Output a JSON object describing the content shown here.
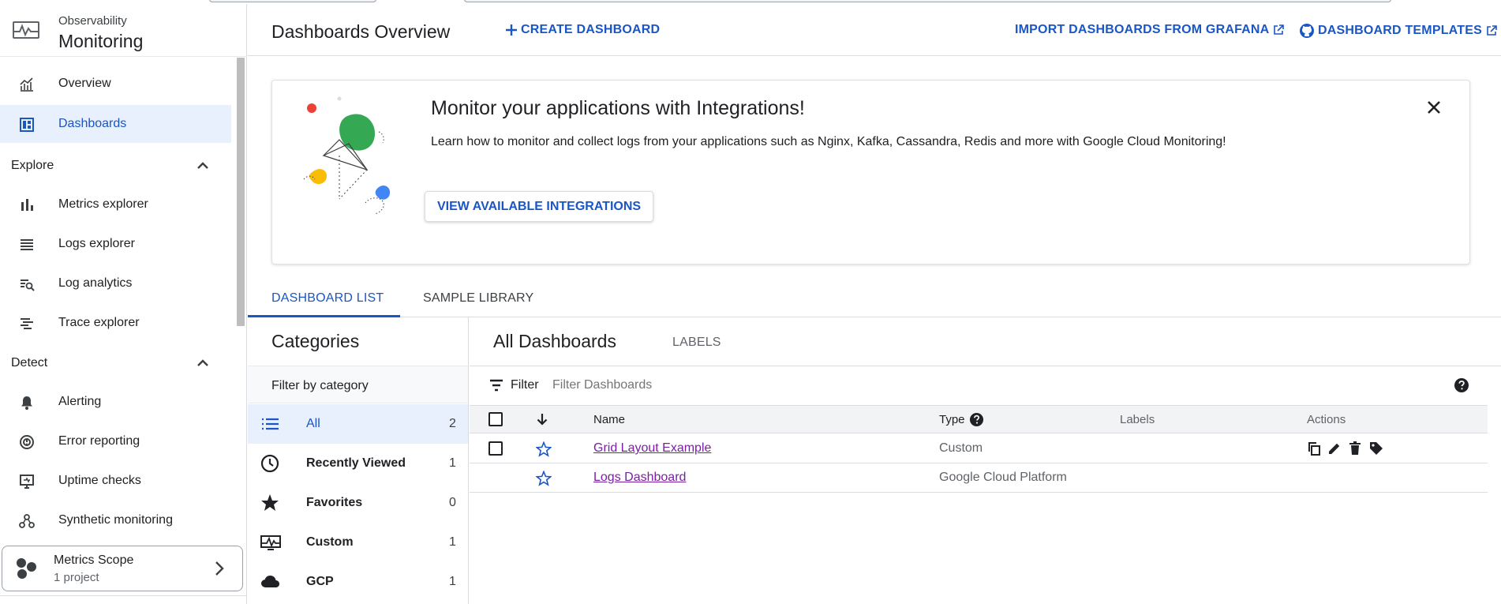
{
  "sidebar": {
    "product_group": "Observability",
    "product_name": "Monitoring",
    "items_top": [
      {
        "label": "Overview",
        "icon": "chart-line-icon"
      },
      {
        "label": "Dashboards",
        "icon": "dashboard-icon",
        "active": true
      }
    ],
    "explore": {
      "heading": "Explore",
      "items": [
        {
          "label": "Metrics explorer",
          "icon": "bar-chart-icon"
        },
        {
          "label": "Logs explorer",
          "icon": "list-lines-icon"
        },
        {
          "label": "Log analytics",
          "icon": "list-search-icon"
        },
        {
          "label": "Trace explorer",
          "icon": "trace-icon"
        }
      ]
    },
    "detect": {
      "heading": "Detect",
      "items": [
        {
          "label": "Alerting",
          "icon": "bell-icon"
        },
        {
          "label": "Error reporting",
          "icon": "error-reporting-icon"
        },
        {
          "label": "Uptime checks",
          "icon": "monitor-icon"
        },
        {
          "label": "Synthetic monitoring",
          "icon": "nodes-icon"
        }
      ]
    },
    "metrics_scope": {
      "title": "Metrics Scope",
      "subtitle": "1 project"
    }
  },
  "header": {
    "title": "Dashboards Overview",
    "create_label": "CREATE DASHBOARD",
    "import_label": "IMPORT DASHBOARDS FROM GRAFANA",
    "templates_label": "DASHBOARD TEMPLATES"
  },
  "banner": {
    "title": "Monitor your applications with Integrations!",
    "description": "Learn how to monitor and collect logs from your applications such as Nginx, Kafka, Cassandra, Redis and more with Google Cloud Monitoring!",
    "button_label": "VIEW AVAILABLE INTEGRATIONS"
  },
  "tabs": [
    {
      "label": "DASHBOARD LIST",
      "active": true
    },
    {
      "label": "SAMPLE LIBRARY",
      "active": false
    }
  ],
  "categories": {
    "title": "Categories",
    "filter_label": "Filter by category",
    "items": [
      {
        "label": "All",
        "count": "2",
        "icon": "list-icon",
        "active": true
      },
      {
        "label": "Recently Viewed",
        "count": "1",
        "icon": "clock-icon"
      },
      {
        "label": "Favorites",
        "count": "0",
        "icon": "star-icon"
      },
      {
        "label": "Custom",
        "count": "1",
        "icon": "monitoring-icon"
      },
      {
        "label": "GCP",
        "count": "1",
        "icon": "cloud-icon"
      }
    ]
  },
  "dashboards": {
    "title": "All Dashboards",
    "labels_tab": "LABELS",
    "filter_label": "Filter",
    "filter_placeholder": "Filter Dashboards",
    "columns": {
      "name": "Name",
      "type": "Type",
      "labels": "Labels",
      "actions": "Actions"
    },
    "rows": [
      {
        "name": "Grid Layout Example",
        "type": "Custom",
        "selectable": true,
        "actions": [
          "copy-icon",
          "edit-icon",
          "delete-icon",
          "label-icon"
        ]
      },
      {
        "name": "Logs Dashboard",
        "type": "Google Cloud Platform",
        "selectable": false,
        "actions": []
      }
    ]
  },
  "colors": {
    "accent": "#1a56c4",
    "active_bg": "#e8f0fe",
    "link_visited": "#7b1fa2",
    "art_green": "#34a853",
    "art_blue": "#4285f4",
    "art_yellow": "#fbbc04",
    "art_red": "#ea4335"
  }
}
